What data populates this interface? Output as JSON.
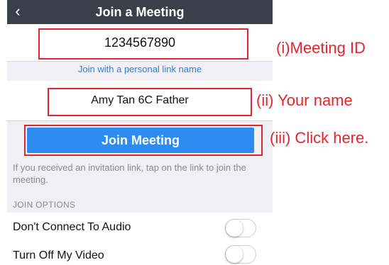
{
  "nav": {
    "title": "Join a Meeting",
    "back_icon": "chevron-left-icon"
  },
  "form": {
    "meeting_id_value": "1234567890",
    "personal_link_text": "Join with a personal link name",
    "name_value": "Amy Tan 6C Father",
    "join_button_label": "Join Meeting",
    "help_text": "If you received an invitation link, tap on the link to join the meeting."
  },
  "options": {
    "section_header": "JOIN OPTIONS",
    "items": [
      {
        "label": "Don't Connect To Audio",
        "enabled": false
      },
      {
        "label": "Turn Off My Video",
        "enabled": false
      }
    ]
  },
  "annotations": {
    "meeting_id": "(i)Meeting ID",
    "your_name": "(ii) Your name",
    "click_here": "(iii) Click here."
  },
  "colors": {
    "nav_bg": "#3b3f4a",
    "accent_blue": "#2e8cf0",
    "link_blue": "#2d7fe0",
    "annotation_red": "#e3262e",
    "screen_bg": "#efeff4"
  }
}
